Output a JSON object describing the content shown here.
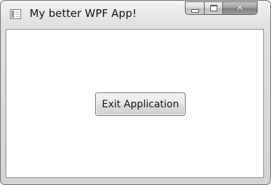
{
  "window": {
    "title": "My better WPF App!",
    "app_icon": "window-app-icon",
    "caption_buttons": {
      "minimize": {
        "icon": "minimize-icon"
      },
      "maximize": {
        "icon": "maximize-icon"
      },
      "close": {
        "icon": "close-icon",
        "glyph": "✕"
      }
    }
  },
  "content": {
    "exit_button_label": "Exit Application"
  }
}
